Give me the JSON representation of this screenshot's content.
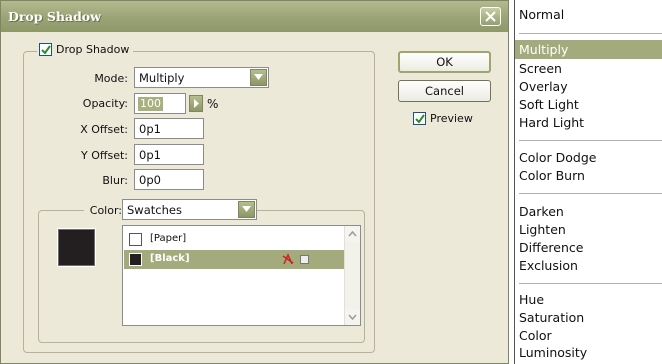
{
  "dialog": {
    "title": "Drop Shadow",
    "drop_shadow_label": "Drop Shadow",
    "drop_shadow_checked": true,
    "mode_label": "Mode:",
    "mode_value": "Multiply",
    "opacity_label": "Opacity:",
    "opacity_value": "100",
    "opacity_unit": "%",
    "x_offset_label": "X Offset:",
    "x_offset_value": "0p1",
    "y_offset_label": "Y Offset:",
    "y_offset_value": "0p1",
    "blur_label": "Blur:",
    "blur_value": "0p0",
    "color_label": "Color:",
    "color_value": "Swatches",
    "swatches": [
      {
        "name": "[Paper]",
        "color": "#ffffff",
        "selected": false
      },
      {
        "name": "[Black]",
        "color": "#231f20",
        "selected": true
      }
    ],
    "ok_label": "OK",
    "cancel_label": "Cancel",
    "preview_label": "Preview",
    "preview_checked": true
  },
  "blend_menu": {
    "selected": "Multiply",
    "groups": [
      [
        "Normal"
      ],
      [
        "Multiply",
        "Screen",
        "Overlay",
        "Soft Light",
        "Hard Light"
      ],
      [
        "Color Dodge",
        "Color Burn"
      ],
      [
        "Darken",
        "Lighten",
        "Difference",
        "Exclusion"
      ],
      [
        "Hue",
        "Saturation",
        "Color",
        "Luminosity"
      ]
    ]
  },
  "colors": {
    "accent": "#a3ab7c",
    "titlebar": "#9aa376",
    "dialog_bg": "#ece9d8",
    "black_swatch": "#231f20"
  }
}
